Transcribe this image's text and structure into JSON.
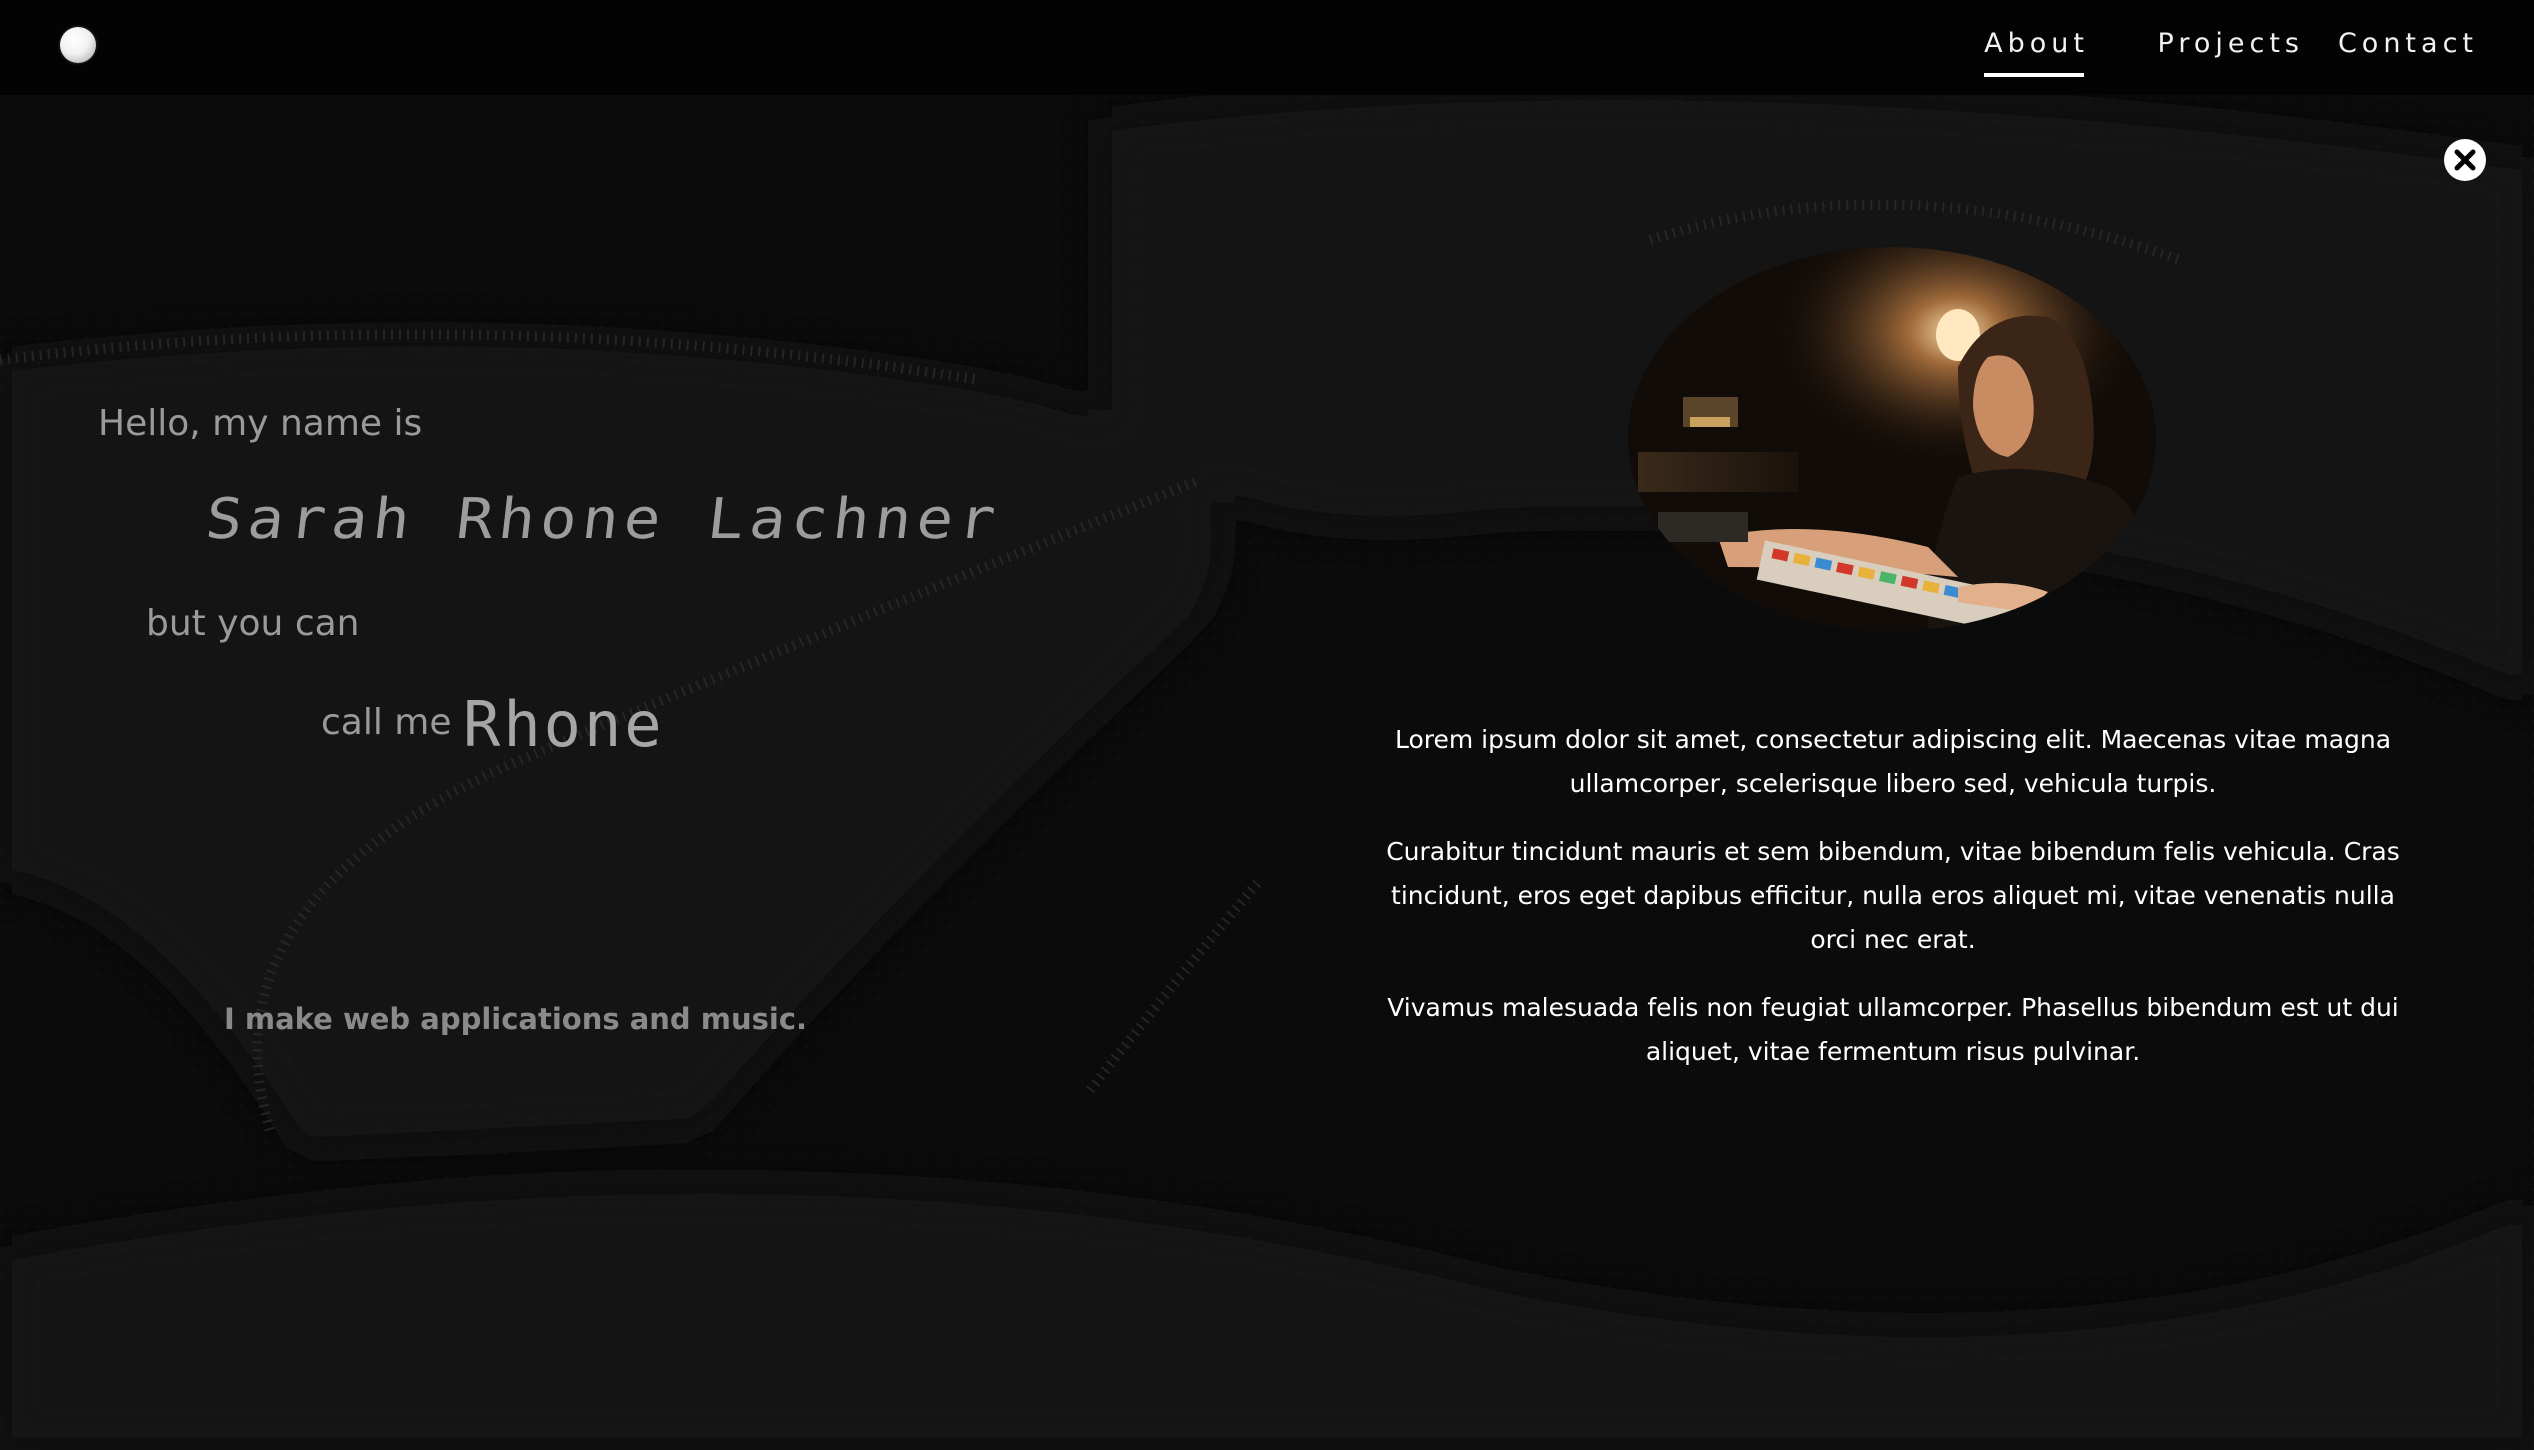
{
  "nav": {
    "logo": "logo-dot",
    "items": [
      {
        "label": "About",
        "active": true
      },
      {
        "label": "Projects",
        "active": false
      },
      {
        "label": "Contact",
        "active": false
      }
    ]
  },
  "close_icon": "close-circle-icon",
  "intro": {
    "greeting": "Hello, my name is",
    "full_name": "Sarah Rhone Lachner",
    "but_you_can": "but you can",
    "call_me": "call me",
    "nickname": "Rhone",
    "tagline": "I make web applications and music."
  },
  "about": {
    "paragraphs": [
      "Lorem ipsum dolor sit amet, consectetur adipiscing elit. Maecenas vitae magna ullamcorper, scelerisque libero sed, vehicula turpis.",
      "Curabitur tincidunt mauris et sem bibendum, vitae bibendum felis vehicula. Cras tincidunt, eros eget dapibus efficitur, nulla eros aliquet mi, vitae venenatis nulla orci nec erat.",
      "Vivamus malesuada felis non feugiat ullamcorper. Phasellus bibendum est ut dui aliquet, vitae fermentum risus pulvinar."
    ]
  },
  "colors": {
    "background": "#0b0b0b",
    "topbar": "#030303",
    "text_primary": "#ffffff",
    "text_muted": "#9a9a9a"
  }
}
